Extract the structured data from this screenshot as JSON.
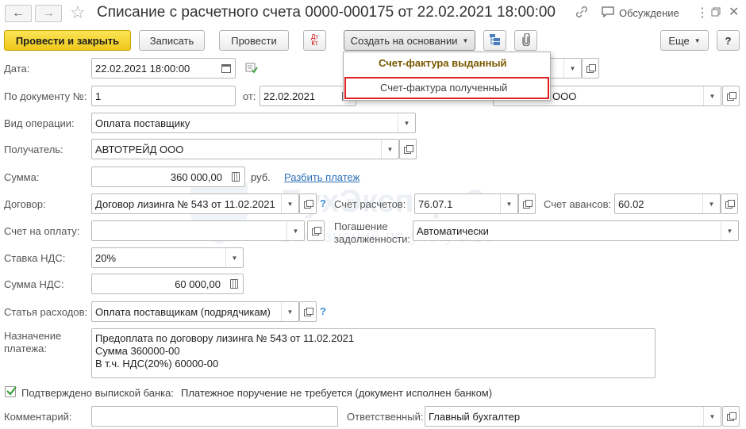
{
  "window": {
    "title": "Списание с расчетного счета 0000-000175 от 22.02.2021 18:00:00",
    "discussion_label": "Обсуждение"
  },
  "toolbar": {
    "post_close": "Провести и закрыть",
    "save": "Записать",
    "post": "Провести",
    "dt_kt": "ДтКт",
    "create_based_on": "Создать на основании",
    "more": "Еще",
    "help": "?"
  },
  "menu": {
    "items": [
      "Счет-фактура выданный",
      "Счет-фактура полученный"
    ]
  },
  "form": {
    "date_label": "Дата:",
    "date_value": "22.02.2021 18:00:00",
    "doc_label": "По документу №:",
    "doc_value": "1",
    "from_label": "от:",
    "from_value": "22.02.2021",
    "org_value": "ООО",
    "op_label": "Вид операции:",
    "op_value": "Оплата поставщику",
    "recipient_label": "Получатель:",
    "recipient_value": "АВТОТРЕЙД ООО",
    "sum_label": "Сумма:",
    "sum_value": "360 000,00",
    "currency": "руб.",
    "split_link": "Разбить платеж",
    "contract_label": "Договор:",
    "contract_value": "Договор лизинга № 543 от 11.02.2021",
    "settle_label": "Счет расчетов:",
    "settle_value": "76.07.1",
    "advance_label": "Счет авансов:",
    "advance_value": "60.02",
    "invoice_label": "Счет на оплату:",
    "invoice_value": "",
    "repay_label_1": "Погашение",
    "repay_label_2": "задолженности:",
    "repay_value": "Автоматически",
    "vat_rate_label": "Ставка НДС:",
    "vat_rate_value": "20%",
    "vat_sum_label": "Сумма НДС:",
    "vat_sum_value": "60 000,00",
    "expense_label": "Статья расходов:",
    "expense_value": "Оплата поставщикам (подрядчикам)",
    "purpose_label_1": "Назначение",
    "purpose_label_2": "платежа:",
    "purpose_lines": [
      "Предоплата по договору лизинга № 543 от 11.02.2021",
      "Сумма 360000-00",
      "В т.ч. НДС(20%) 60000-00"
    ],
    "confirmed_label": "Подтверждено выпиской банка:",
    "confirmed_note": "Платежное поручение не требуется (документ исполнен банком)",
    "comment_label": "Комментарий:",
    "comment_value": "",
    "responsible_label": "Ответственный:",
    "responsible_value": "Главный бухгалтер"
  },
  "watermark": {
    "title": "БухЭксперт8",
    "subtitle": "База знаний по учету в 1С"
  },
  "colors": {
    "accent_yellow": "#f4d227",
    "highlight_red": "#e0201f",
    "link_blue": "#2d70b7"
  }
}
